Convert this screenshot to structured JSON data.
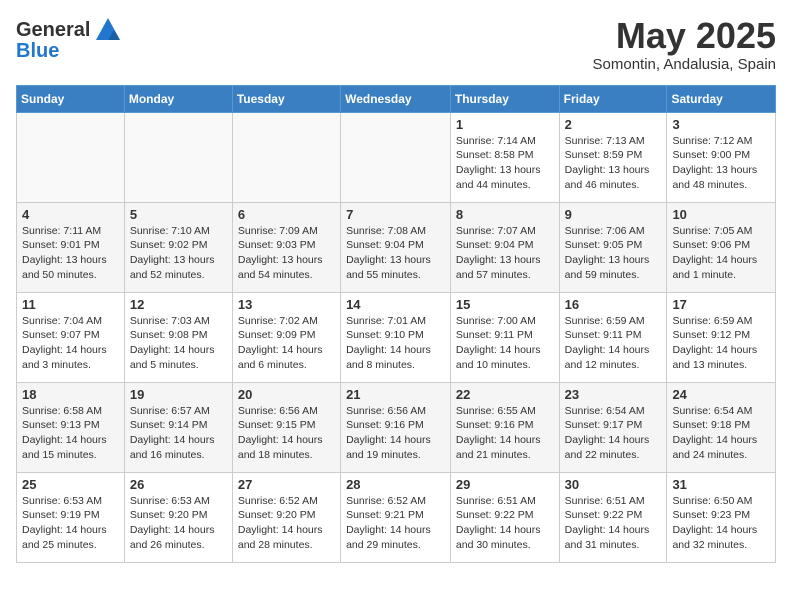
{
  "header": {
    "logo_line1": "General",
    "logo_line2": "Blue",
    "month_title": "May 2025",
    "location": "Somontin, Andalusia, Spain"
  },
  "weekdays": [
    "Sunday",
    "Monday",
    "Tuesday",
    "Wednesday",
    "Thursday",
    "Friday",
    "Saturday"
  ],
  "weeks": [
    [
      {
        "day": "",
        "info": ""
      },
      {
        "day": "",
        "info": ""
      },
      {
        "day": "",
        "info": ""
      },
      {
        "day": "",
        "info": ""
      },
      {
        "day": "1",
        "info": "Sunrise: 7:14 AM\nSunset: 8:58 PM\nDaylight: 13 hours\nand 44 minutes."
      },
      {
        "day": "2",
        "info": "Sunrise: 7:13 AM\nSunset: 8:59 PM\nDaylight: 13 hours\nand 46 minutes."
      },
      {
        "day": "3",
        "info": "Sunrise: 7:12 AM\nSunset: 9:00 PM\nDaylight: 13 hours\nand 48 minutes."
      }
    ],
    [
      {
        "day": "4",
        "info": "Sunrise: 7:11 AM\nSunset: 9:01 PM\nDaylight: 13 hours\nand 50 minutes."
      },
      {
        "day": "5",
        "info": "Sunrise: 7:10 AM\nSunset: 9:02 PM\nDaylight: 13 hours\nand 52 minutes."
      },
      {
        "day": "6",
        "info": "Sunrise: 7:09 AM\nSunset: 9:03 PM\nDaylight: 13 hours\nand 54 minutes."
      },
      {
        "day": "7",
        "info": "Sunrise: 7:08 AM\nSunset: 9:04 PM\nDaylight: 13 hours\nand 55 minutes."
      },
      {
        "day": "8",
        "info": "Sunrise: 7:07 AM\nSunset: 9:04 PM\nDaylight: 13 hours\nand 57 minutes."
      },
      {
        "day": "9",
        "info": "Sunrise: 7:06 AM\nSunset: 9:05 PM\nDaylight: 13 hours\nand 59 minutes."
      },
      {
        "day": "10",
        "info": "Sunrise: 7:05 AM\nSunset: 9:06 PM\nDaylight: 14 hours\nand 1 minute."
      }
    ],
    [
      {
        "day": "11",
        "info": "Sunrise: 7:04 AM\nSunset: 9:07 PM\nDaylight: 14 hours\nand 3 minutes."
      },
      {
        "day": "12",
        "info": "Sunrise: 7:03 AM\nSunset: 9:08 PM\nDaylight: 14 hours\nand 5 minutes."
      },
      {
        "day": "13",
        "info": "Sunrise: 7:02 AM\nSunset: 9:09 PM\nDaylight: 14 hours\nand 6 minutes."
      },
      {
        "day": "14",
        "info": "Sunrise: 7:01 AM\nSunset: 9:10 PM\nDaylight: 14 hours\nand 8 minutes."
      },
      {
        "day": "15",
        "info": "Sunrise: 7:00 AM\nSunset: 9:11 PM\nDaylight: 14 hours\nand 10 minutes."
      },
      {
        "day": "16",
        "info": "Sunrise: 6:59 AM\nSunset: 9:11 PM\nDaylight: 14 hours\nand 12 minutes."
      },
      {
        "day": "17",
        "info": "Sunrise: 6:59 AM\nSunset: 9:12 PM\nDaylight: 14 hours\nand 13 minutes."
      }
    ],
    [
      {
        "day": "18",
        "info": "Sunrise: 6:58 AM\nSunset: 9:13 PM\nDaylight: 14 hours\nand 15 minutes."
      },
      {
        "day": "19",
        "info": "Sunrise: 6:57 AM\nSunset: 9:14 PM\nDaylight: 14 hours\nand 16 minutes."
      },
      {
        "day": "20",
        "info": "Sunrise: 6:56 AM\nSunset: 9:15 PM\nDaylight: 14 hours\nand 18 minutes."
      },
      {
        "day": "21",
        "info": "Sunrise: 6:56 AM\nSunset: 9:16 PM\nDaylight: 14 hours\nand 19 minutes."
      },
      {
        "day": "22",
        "info": "Sunrise: 6:55 AM\nSunset: 9:16 PM\nDaylight: 14 hours\nand 21 minutes."
      },
      {
        "day": "23",
        "info": "Sunrise: 6:54 AM\nSunset: 9:17 PM\nDaylight: 14 hours\nand 22 minutes."
      },
      {
        "day": "24",
        "info": "Sunrise: 6:54 AM\nSunset: 9:18 PM\nDaylight: 14 hours\nand 24 minutes."
      }
    ],
    [
      {
        "day": "25",
        "info": "Sunrise: 6:53 AM\nSunset: 9:19 PM\nDaylight: 14 hours\nand 25 minutes."
      },
      {
        "day": "26",
        "info": "Sunrise: 6:53 AM\nSunset: 9:20 PM\nDaylight: 14 hours\nand 26 minutes."
      },
      {
        "day": "27",
        "info": "Sunrise: 6:52 AM\nSunset: 9:20 PM\nDaylight: 14 hours\nand 28 minutes."
      },
      {
        "day": "28",
        "info": "Sunrise: 6:52 AM\nSunset: 9:21 PM\nDaylight: 14 hours\nand 29 minutes."
      },
      {
        "day": "29",
        "info": "Sunrise: 6:51 AM\nSunset: 9:22 PM\nDaylight: 14 hours\nand 30 minutes."
      },
      {
        "day": "30",
        "info": "Sunrise: 6:51 AM\nSunset: 9:22 PM\nDaylight: 14 hours\nand 31 minutes."
      },
      {
        "day": "31",
        "info": "Sunrise: 6:50 AM\nSunset: 9:23 PM\nDaylight: 14 hours\nand 32 minutes."
      }
    ]
  ]
}
